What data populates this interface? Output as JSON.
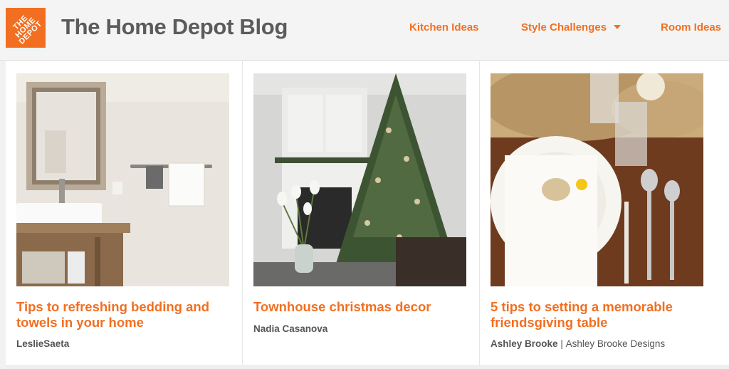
{
  "header": {
    "logo_text": "THE HOME DEPOT",
    "title": "The Home Depot Blog",
    "nav": [
      {
        "label": "Kitchen Ideas"
      },
      {
        "label": "Style Challenges",
        "has_dropdown": true
      },
      {
        "label": "Room Ideas"
      }
    ]
  },
  "colors": {
    "brand_orange": "#f26f21",
    "title_gray": "#5b5b5b"
  },
  "cards": [
    {
      "image": "bathroom-vanity-towels",
      "title": "Tips to refreshing bedding and towels in your home",
      "author": "LeslieSaeta"
    },
    {
      "image": "christmas-tree-living-room",
      "title": "Townhouse christmas decor",
      "author": "Nadia Casanova"
    },
    {
      "image": "friendsgiving-table-setting",
      "title": "5 tips to setting a memorable friendsgiving table",
      "author": "Ashley Brooke",
      "separator": "|",
      "company": "Ashley Brooke Designs"
    }
  ]
}
